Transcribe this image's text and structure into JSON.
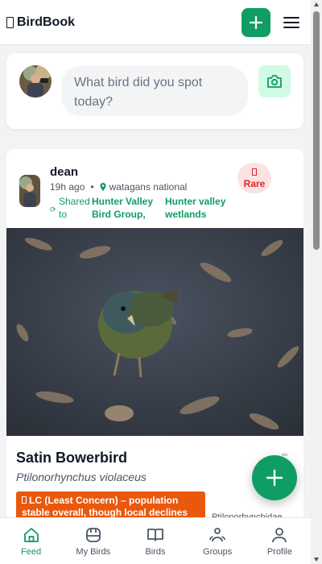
{
  "header": {
    "brand": "BirdBook",
    "brand_icon": "app-logo-icon",
    "add_icon": "plus-icon",
    "menu_icon": "hamburger-menu-icon"
  },
  "composer": {
    "placeholder": "What bird did you spot today?",
    "camera_icon": "camera-icon"
  },
  "post": {
    "username": "dean",
    "time": "19h ago",
    "location": "watagans national",
    "shared_label": "Shared to",
    "groups": [
      "Hunter Valley Bird Group,",
      "Hunter valley wetlands"
    ],
    "rare_label": "Rare",
    "species": "Satin Bowerbird",
    "scientific_name": "Ptilonorhynchus violaceus",
    "status": "LC (Least Concern) – population stable overall, though local declines",
    "family": "Ptilonorhynchidae"
  },
  "nav": [
    {
      "label": "Feed",
      "icon": "home-icon",
      "active": true
    },
    {
      "label": "My Birds",
      "icon": "binoculars-icon",
      "active": false
    },
    {
      "label": "Birds",
      "icon": "book-icon",
      "active": false
    },
    {
      "label": "Groups",
      "icon": "users-icon",
      "active": false
    },
    {
      "label": "Profile",
      "icon": "user-icon",
      "active": false
    }
  ],
  "colors": {
    "accent": "#0f9d63",
    "rare": "#dc2626",
    "status": "#ea580c"
  }
}
